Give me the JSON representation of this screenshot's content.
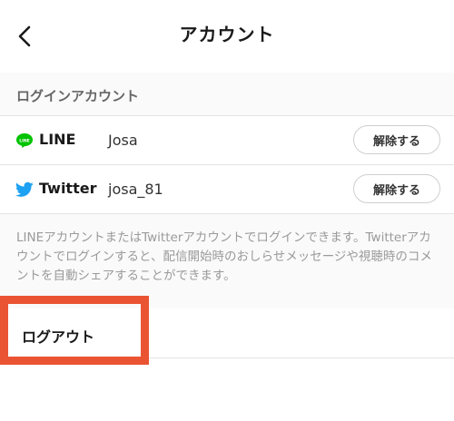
{
  "header": {
    "title": "アカウント",
    "back_icon": "chevron-left-icon"
  },
  "login_section": {
    "title": "ログインアカウント",
    "accounts": [
      {
        "service": "LINE",
        "icon": "line-logo-icon",
        "icon_label": "LINE",
        "brand_color": "#00c300",
        "username": "Josa",
        "unlink_label": "解除する"
      },
      {
        "service": "Twitter",
        "icon": "twitter-bird-icon",
        "brand_color": "#1da1f2",
        "username": "josa_81",
        "unlink_label": "解除する"
      }
    ]
  },
  "info": {
    "text": "LINEアカウントまたはTwitterアカウントでログインできます。Twitterアカウントでログインすると、配信開始時のおしらせメッセージや視聴時のコメントを自動シェアすることができます。"
  },
  "logout": {
    "label": "ログアウト",
    "highlight_color": "#ea5433"
  }
}
